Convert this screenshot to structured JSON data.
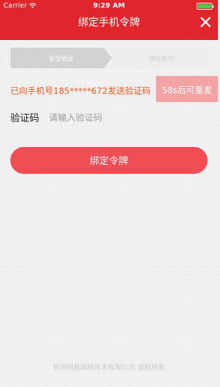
{
  "status_bar": {
    "carrier": "Carrier",
    "time": "9:29 AM"
  },
  "nav": {
    "title": "绑定手机令牌",
    "close_icon": "close-icon"
  },
  "steps": [
    {
      "label": "安全验证",
      "state": "active"
    },
    {
      "label": "绑定成功",
      "state": "inactive"
    }
  ],
  "verification": {
    "notice": "已向手机号185*****672发送验证码",
    "resend_label": "58s后可重发",
    "code_label": "验证码",
    "code_placeholder": "请输入验证码",
    "code_value": ""
  },
  "actions": {
    "bind_label": "绑定令牌"
  },
  "footer": {
    "text": "杭州网易网络技术有限公司 版权所有"
  },
  "colors": {
    "header_bg": "#e0262c",
    "notice": "#f05a1e",
    "resend_bg": "#f3a3a3",
    "bind_button": "#f14d55"
  }
}
